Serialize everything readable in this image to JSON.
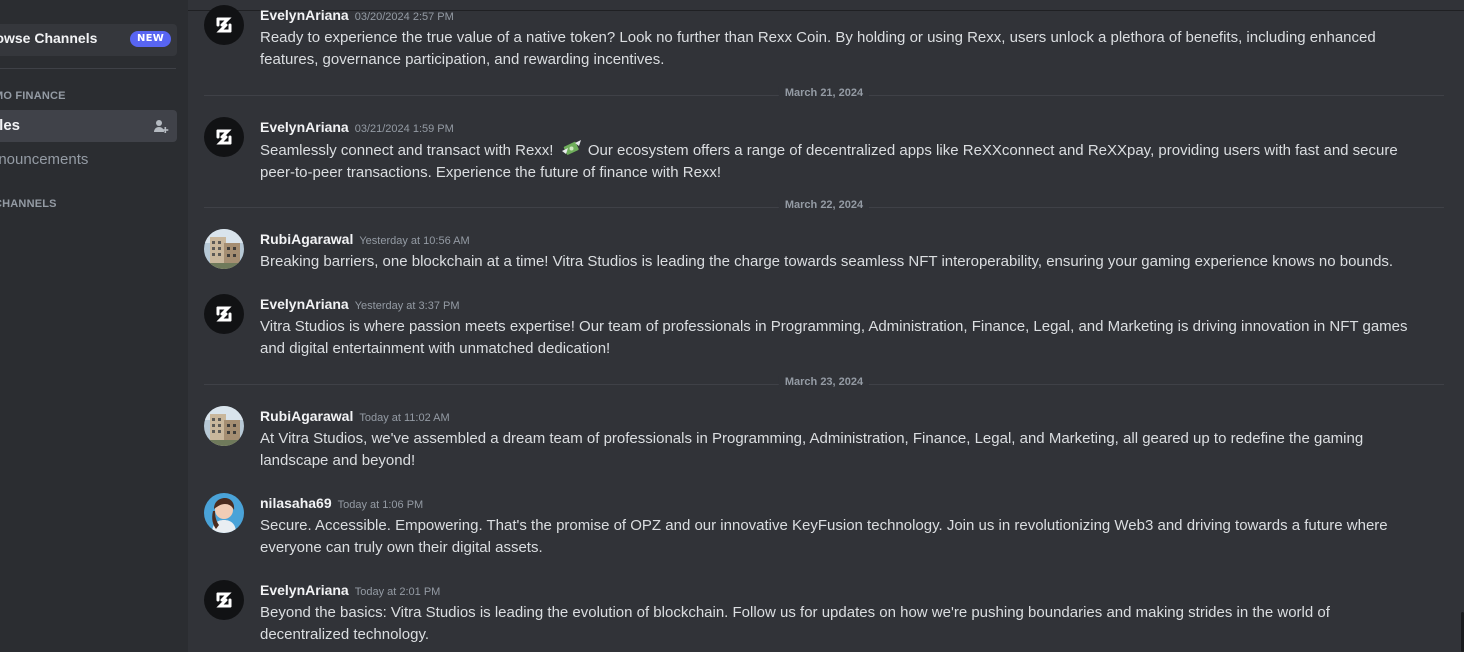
{
  "sidebar": {
    "browse_channels": "rowse Channels",
    "new_badge": "NEW",
    "category_1": "MO FINANCE",
    "channels": [
      {
        "label": "ules"
      },
      {
        "label": "nnouncements"
      }
    ],
    "category_2": "CHANNELS"
  },
  "messages": [
    {
      "user": "EvelynAriana",
      "timestamp": "03/20/2024 2:57 PM",
      "text": "Ready to experience the true value of a native token? Look no further than Rexx Coin. By holding or using Rexx, users unlock a plethora of benefits, including enhanced features, governance participation, and rewarding incentives."
    },
    {
      "user": "EvelynAriana",
      "timestamp": "03/21/2024 1:59 PM",
      "text_before_emoji": "Seamlessly connect and transact with Rexx!",
      "emoji": "money-with-wings",
      "text_after_emoji": "Our ecosystem offers a range of decentralized apps like ReXXconnect and ReXXpay, providing users with fast and secure peer-to-peer transactions. Experience the future of finance with Rexx!"
    },
    {
      "user": "RubiAgarawal",
      "timestamp": "Yesterday at 10:56 AM",
      "text": "Breaking barriers, one blockchain at a time! Vitra Studios is leading the charge towards seamless NFT interoperability, ensuring your gaming experience knows no bounds."
    },
    {
      "user": "EvelynAriana",
      "timestamp": "Yesterday at 3:37 PM",
      "text": "Vitra Studios is where passion meets expertise! Our team of professionals in Programming, Administration, Finance, Legal, and Marketing is driving innovation in NFT games and digital entertainment with unmatched dedication!"
    },
    {
      "user": "RubiAgarawal",
      "timestamp": "Today at 11:02 AM",
      "text": "At Vitra Studios, we've assembled a dream team of professionals in Programming, Administration, Finance, Legal, and Marketing, all geared up to redefine the gaming landscape and beyond!"
    },
    {
      "user": "nilasaha69",
      "timestamp": "Today at 1:06 PM",
      "text": "Secure. Accessible. Empowering. That's the promise of OPZ and our innovative KeyFusion technology. Join us in revolutionizing Web3 and driving towards a future where everyone can truly own their digital assets."
    },
    {
      "user": "EvelynAriana",
      "timestamp": "Today at 2:01 PM",
      "text": "Beyond the basics: Vitra Studios is leading the evolution of blockchain. Follow us for updates on how we're pushing boundaries and making strides in the world of decentralized technology."
    }
  ],
  "date_separators": [
    "March 21, 2024",
    "March 22, 2024",
    "March 23, 2024"
  ],
  "colors": {
    "background": "#313338",
    "sidebar": "#2b2d31",
    "accent": "#5865f2",
    "username": "#f2f3f5",
    "message_text": "#dbdee1",
    "muted": "#949ba4"
  }
}
